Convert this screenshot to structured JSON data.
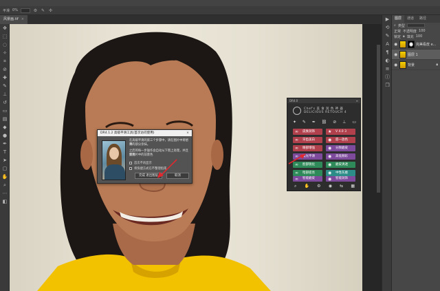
{
  "options_bar": {
    "tool_label": "平滑",
    "value": "0%"
  },
  "document_tab": {
    "label": "风景画.tif",
    "close": "×"
  },
  "layers_panel": {
    "tabs": [
      "图层",
      "通道",
      "路径"
    ],
    "kind_label": "类型",
    "blend_mode": "正常",
    "opacity_label": "不透明度",
    "opacity_value": "100",
    "lock_label": "锁定",
    "fill_label": "填充",
    "fill_value": "100",
    "layers": [
      {
        "name": "完美看皮 e...",
        "has_mask": true
      },
      {
        "name": "图层 1",
        "has_mask": false
      },
      {
        "name": "背景",
        "has_mask": false
      }
    ]
  },
  "plugin_panel": {
    "header": "DR4.0",
    "title_line1": "Chef's 美 食 润 色 神 器",
    "title_line2": "DELICIOUS RETOUCH 4",
    "buttons_left": [
      "皮肤润饰",
      "牙齿美白",
      "眼部增强",
      "柔光平滑",
      "脸部锐化",
      "暗部提亮",
      "智能磨皮"
    ],
    "buttons_right": [
      "V 4.0 3",
      "唇一放色",
      "分频磨皮",
      "高低频彩",
      "磨皮清透",
      "中性灰磨",
      "智能润饰"
    ],
    "button_colors": {
      "red": "#b1404d",
      "purple": "#7d4a9c",
      "green": "#2e8a58",
      "teal": "#2c8c88"
    }
  },
  "dialog": {
    "title": "DR4.1.2 高级平滑工具(首次访问使用)",
    "close": "×",
    "text_lines": [
      "在高级平滑的第三个步骤中，请在图片中将想平",
      "滑的部分涂抹。",
      "之后的每一步操作会自动从下而上处理，并且使用",
      "到图片中的前景色"
    ],
    "checkbox1_label": "首次不再显示",
    "checkbox2_label": "将快捷方式在不整理指南",
    "primary_button": "完成 退出图层",
    "cancel_button": "取消"
  },
  "colors": {
    "accent_red_arrow": "#e0282e",
    "photoshop_panel": "#474747",
    "canvas_wall": "#e6e1d1",
    "shirt_yellow": "#f2c100"
  }
}
